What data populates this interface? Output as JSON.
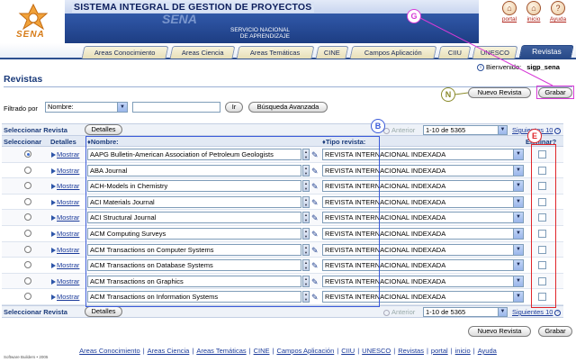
{
  "header": {
    "logo_text": "SENA",
    "title": "SISTEMA INTEGRAL DE GESTION DE PROYECTOS",
    "watermark": "SENA",
    "subtitle_line1": "SERVICIO NACIONAL",
    "subtitle_line2": "DE APRENDIZAJE",
    "top_links": [
      {
        "label": "portal",
        "icon": "house-icon"
      },
      {
        "label": "inicio",
        "icon": "home-icon"
      },
      {
        "label": "Ayuda",
        "icon": "help-icon"
      }
    ]
  },
  "tabs": [
    {
      "label": "Areas Conocimiento"
    },
    {
      "label": "Areas Ciencia"
    },
    {
      "label": "Areas Temáticas"
    },
    {
      "label": "CINE"
    },
    {
      "label": "Campos Aplicación"
    },
    {
      "label": "CIIU"
    },
    {
      "label": "UNESCO"
    },
    {
      "label": "Revistas",
      "active": true
    }
  ],
  "welcome": {
    "label": "Bienvenido:",
    "user": "sigp_sena"
  },
  "page_title": "Revistas",
  "actions": {
    "nuevo": "Nuevo Revista",
    "grabar": "Grabar"
  },
  "filter": {
    "label": "Filtrado por",
    "field": "Nombre:",
    "value": "",
    "ir": "Ir",
    "avanzada": "Búsqueda Avanzada"
  },
  "table": {
    "select_label": "Seleccionar Revista",
    "details_button": "Detalles",
    "columns": {
      "select": "Seleccionar",
      "details": "Detalles",
      "name": "Nombre:",
      "type": "Tipo revista:",
      "delete": "Eliminar?"
    },
    "pager": {
      "anterior": "Anterior",
      "range": "1-10 de 5365",
      "siguientes": "Siguientes 10"
    },
    "mostrar_label": "Mostrar",
    "rows": [
      {
        "name": "AAPG Bulletin-American Association of Petroleum Geologists",
        "type": "REVISTA INTERNACIONAL INDEXADA",
        "selected": true
      },
      {
        "name": "ABA Journal",
        "type": "REVISTA INTERNACIONAL INDEXADA"
      },
      {
        "name": "ACH-Models in Chemistry",
        "type": "REVISTA INTERNACIONAL INDEXADA"
      },
      {
        "name": "ACI Materials Journal",
        "type": "REVISTA INTERNACIONAL INDEXADA"
      },
      {
        "name": "ACI Structural Journal",
        "type": "REVISTA INTERNACIONAL INDEXADA"
      },
      {
        "name": "ACM Computing Surveys",
        "type": "REVISTA INTERNACIONAL INDEXADA"
      },
      {
        "name": "ACM Transactions on Computer Systems",
        "type": "REVISTA INTERNACIONAL INDEXADA"
      },
      {
        "name": "ACM Transactions on Database Systems",
        "type": "REVISTA INTERNACIONAL INDEXADA"
      },
      {
        "name": "ACM Transactions on Graphics",
        "type": "REVISTA INTERNACIONAL INDEXADA"
      },
      {
        "name": "ACM Transactions on Information Systems",
        "type": "REVISTA INTERNACIONAL INDEXADA"
      }
    ]
  },
  "annotations": {
    "b": "B",
    "e": "E",
    "g": "G",
    "n": "N"
  },
  "footer": {
    "links": [
      "Areas Conocimiento",
      "Areas Ciencia",
      "Areas Temáticas",
      "CINE",
      "Campos Aplicación",
      "CIIU",
      "UNESCO",
      "Revistas",
      "portal",
      "inicio",
      "Ayuda"
    ],
    "small": "Software Builders • 2005"
  },
  "colors": {
    "primary": "#264886",
    "link": "#1a3a9a",
    "annotation_blue": "#3b5bd9",
    "annotation_red": "#e0252a",
    "annotation_magenta": "#d63ad6",
    "annotation_olive": "#8a8a2a"
  }
}
